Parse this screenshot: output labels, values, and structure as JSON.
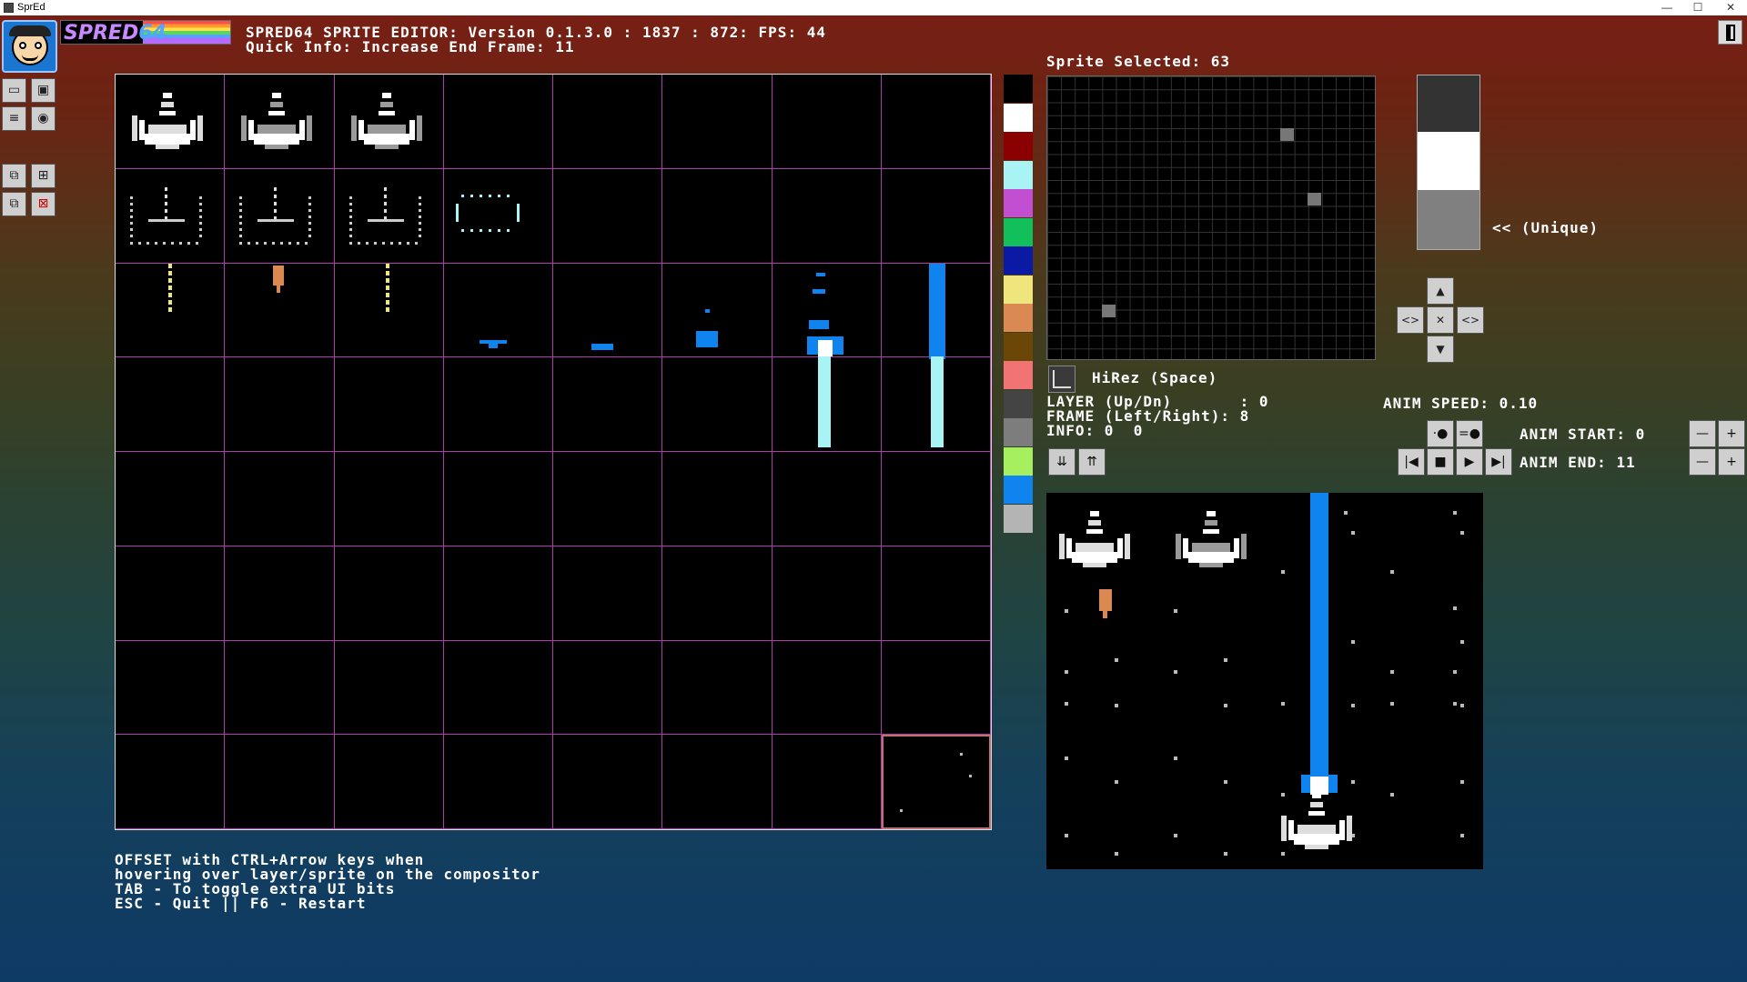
{
  "window": {
    "title": "SprEd",
    "minimize_glyph": "—",
    "maximize_glyph": "☐",
    "close_glyph": "✕"
  },
  "header": {
    "brand": "SPRED",
    "brand_suffix": "64",
    "status_line": "SPRED64 SPRITE EDITOR: Version 0.1.3.0 : 1837 : 872: FPS: 44",
    "quick_info": "Quick Info: Increase End Frame: 11"
  },
  "tools": [
    {
      "name": "new-sheet-icon"
    },
    {
      "name": "save-icon"
    },
    {
      "name": "export-icon"
    },
    {
      "name": "view-icon"
    },
    {
      "name": "copy-icon"
    },
    {
      "name": "add-sprite-icon"
    },
    {
      "name": "paste-icon"
    },
    {
      "name": "delete-icon"
    }
  ],
  "palette": [
    "#000000",
    "#ffffff",
    "#8b0000",
    "#a8f3f3",
    "#c24fd1",
    "#11c05a",
    "#0a1aa5",
    "#eee67c",
    "#d98951",
    "#6b4707",
    "#f27373",
    "#444444",
    "#7d7d7d",
    "#a6ef5e",
    "#0f84ee",
    "#b4b4b4"
  ],
  "editor": {
    "sprite_selected": "Sprite Selected: 63",
    "current_colors": [
      "#333333",
      "#ffffff",
      "#808080"
    ],
    "cc_label": "<<  (Unique)",
    "hirez_label": "HiRez (Space)",
    "layer_line": "LAYER (Up/Dn)       : 0",
    "frame_line": "FRAME (Left/Right): 8",
    "info_line": "INFO: 0  0",
    "anim_speed": "ANIM SPEED: 0.10",
    "anim_start": "ANIM START: 0",
    "anim_end": "ANIM END: 11",
    "minus_glyph": "—",
    "plus_glyph": "+",
    "nav": {
      "up": "▲",
      "down": "▼",
      "left": "<>",
      "right": "<>",
      "center": "✕"
    },
    "transport": {
      "first": "|◀",
      "stop": "■",
      "play": "▶",
      "last": "▶|",
      "mode_a": "·●",
      "mode_b": "=●"
    }
  },
  "help": [
    "OFFSET with CTRL+Arrow keys when",
    "hovering over layer/sprite on the compositor",
    "TAB - To toggle extra UI bits",
    "ESC - Quit || F6 - Restart"
  ]
}
